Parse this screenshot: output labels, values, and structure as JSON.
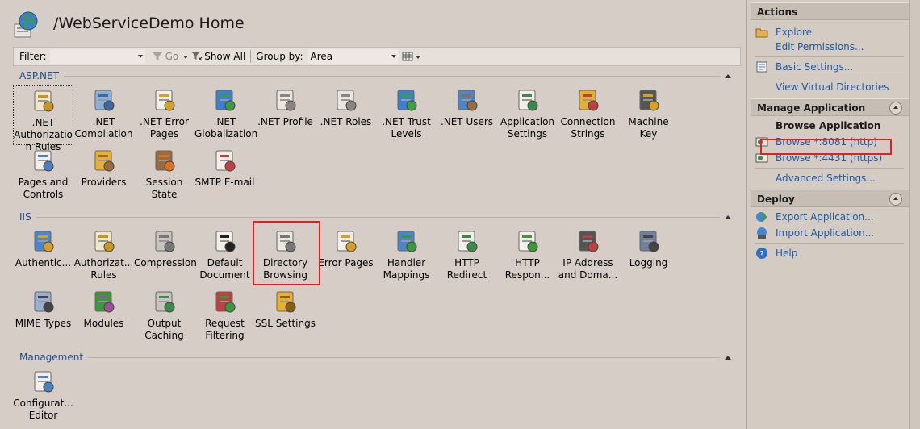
{
  "header": {
    "title": "/WebServiceDemo Home"
  },
  "filterbar": {
    "filter_label": "Filter:",
    "go_label": "Go",
    "show_all_label": "Show All",
    "group_by_label": "Group by:",
    "group_by_value": "Area"
  },
  "groups": {
    "aspnet": "ASP.NET",
    "iis": "IIS",
    "management": "Management"
  },
  "aspnet_items": [
    {
      "label": ".NET\nAuthorizatio\nn Rules",
      "icon": "authorization-lock-icon"
    },
    {
      "label": ".NET\nCompilation",
      "icon": "compilation-icon"
    },
    {
      "label": ".NET Error\nPages",
      "icon": "error-404-icon"
    },
    {
      "label": ".NET\nGlobalization",
      "icon": "globe-icon"
    },
    {
      "label": ".NET Profile",
      "icon": "profile-icon"
    },
    {
      "label": ".NET Roles",
      "icon": "roles-icon"
    },
    {
      "label": ".NET Trust\nLevels",
      "icon": "trust-levels-icon"
    },
    {
      "label": ".NET Users",
      "icon": "users-icon"
    },
    {
      "label": "Application\nSettings",
      "icon": "app-settings-icon"
    },
    {
      "label": "Connection\nStrings",
      "icon": "database-icon"
    },
    {
      "label": "Machine Key",
      "icon": "machine-key-icon"
    },
    {
      "label": "Pages and\nControls",
      "icon": "pages-controls-icon"
    },
    {
      "label": "Providers",
      "icon": "providers-icon"
    },
    {
      "label": "Session State",
      "icon": "session-state-icon"
    },
    {
      "label": "SMTP E-mail",
      "icon": "smtp-email-icon"
    }
  ],
  "iis_items": [
    {
      "label": "Authentic...",
      "icon": "authentication-icon"
    },
    {
      "label": "Authorizat...\nRules",
      "icon": "authorization-rules-icon"
    },
    {
      "label": "Compression",
      "icon": "compression-icon"
    },
    {
      "label": "Default\nDocument",
      "icon": "default-document-icon"
    },
    {
      "label": "Directory\nBrowsing",
      "icon": "directory-browsing-icon"
    },
    {
      "label": "Error Pages",
      "icon": "error-pages-icon"
    },
    {
      "label": "Handler\nMappings",
      "icon": "handler-mappings-icon"
    },
    {
      "label": "HTTP\nRedirect",
      "icon": "http-redirect-icon"
    },
    {
      "label": "HTTP\nRespon...",
      "icon": "http-response-icon"
    },
    {
      "label": "IP Address\nand Doma...",
      "icon": "ip-address-icon"
    },
    {
      "label": "Logging",
      "icon": "logging-icon"
    },
    {
      "label": "MIME Types",
      "icon": "mime-types-icon"
    },
    {
      "label": "Modules",
      "icon": "modules-icon"
    },
    {
      "label": "Output\nCaching",
      "icon": "output-caching-icon"
    },
    {
      "label": "Request\nFiltering",
      "icon": "request-filtering-icon"
    },
    {
      "label": "SSL Settings",
      "icon": "ssl-lock-icon"
    }
  ],
  "management_items": [
    {
      "label": "Configurat...\nEditor",
      "icon": "config-editor-icon"
    }
  ],
  "actions": {
    "title": "Actions",
    "explore": "Explore",
    "edit_permissions": "Edit Permissions...",
    "basic_settings": "Basic Settings...",
    "view_virtual_directories": "View Virtual Directories",
    "manage_application": "Manage Application",
    "browse_application": "Browse Application",
    "browse_http": "Browse *:8081 (http)",
    "browse_https": "Browse *:4431 (https)",
    "advanced_settings": "Advanced Settings...",
    "deploy": "Deploy",
    "export_application": "Export Application...",
    "import_application": "Import Application...",
    "help": "Help"
  },
  "colors": {
    "link": "#1d5aa8",
    "group_header": "#1f4f8f",
    "highlight": "#e02020"
  }
}
